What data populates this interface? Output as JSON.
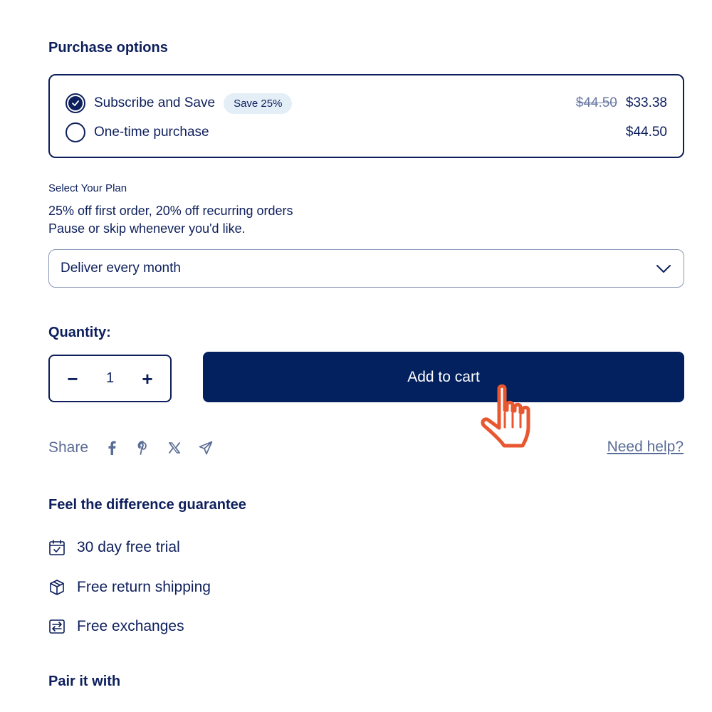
{
  "purchase_options": {
    "heading": "Purchase options",
    "subscribe": {
      "label": "Subscribe and Save",
      "badge": "Save 25%",
      "price_original": "$44.50",
      "price_discounted": "$33.38",
      "selected": true
    },
    "one_time": {
      "label": "One-time purchase",
      "price": "$44.50",
      "selected": false
    }
  },
  "plan": {
    "label": "Select Your Plan",
    "desc_line1": "25% off first order, 20% off recurring orders",
    "desc_line2": "Pause or skip whenever you'd like.",
    "selected_option": "Deliver every month"
  },
  "quantity": {
    "heading": "Quantity:",
    "value": "1",
    "minus": "−",
    "plus": "+"
  },
  "cart": {
    "button_label": "Add to cart"
  },
  "share": {
    "label": "Share",
    "icons": [
      "facebook-icon",
      "pinterest-icon",
      "x-icon",
      "telegram-icon"
    ],
    "help_link": "Need help?"
  },
  "guarantee": {
    "heading": "Feel the difference guarantee",
    "items": [
      {
        "icon": "calendar-check-icon",
        "text": "30 day free trial"
      },
      {
        "icon": "box-icon",
        "text": "Free return shipping"
      },
      {
        "icon": "exchange-icon",
        "text": "Free exchanges"
      }
    ]
  },
  "pair": {
    "heading": "Pair it with"
  },
  "colors": {
    "navy": "#0d1f5c",
    "button": "#03205f",
    "muted": "#5b6d96",
    "badge_bg": "#e4eef7",
    "cursor": "#e8572f"
  }
}
